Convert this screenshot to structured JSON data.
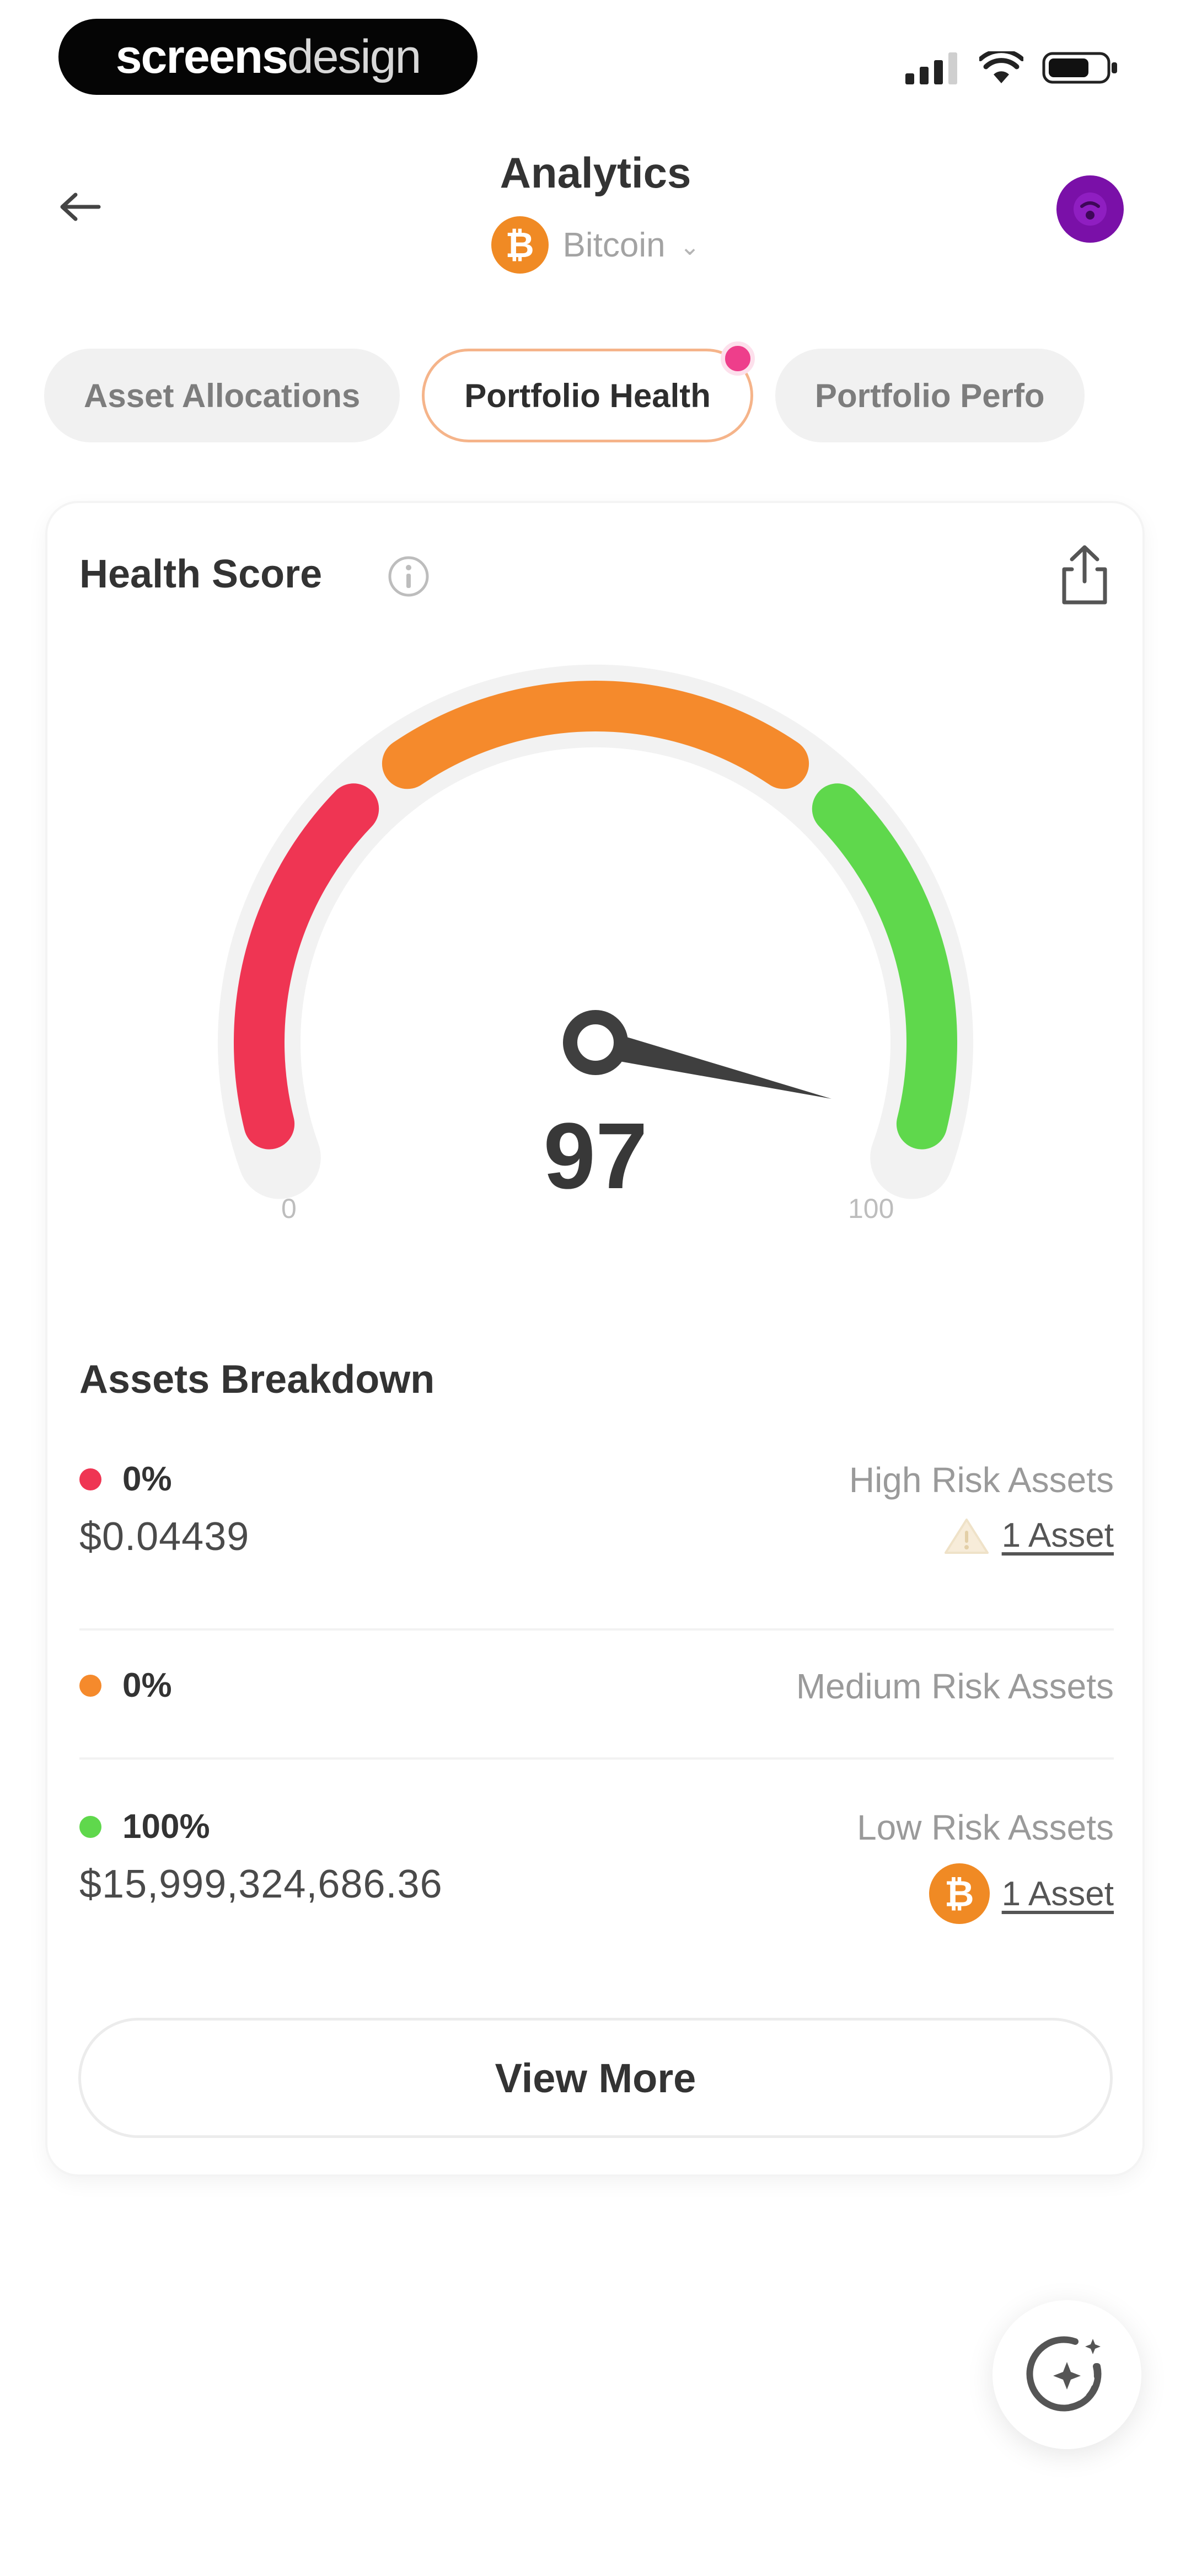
{
  "status_bar": {
    "brand_part1": "screens",
    "brand_part2": "design",
    "icons": [
      "signal-icon",
      "wifi-icon",
      "battery-icon"
    ]
  },
  "header": {
    "title": "Analytics",
    "asset": {
      "symbol": "₿",
      "name": "Bitcoin"
    },
    "back_icon": "arrow-left-icon",
    "avatar_color": "#7a10a8"
  },
  "tabs": [
    {
      "label": "Asset Allocations",
      "active": false
    },
    {
      "label": "Portfolio Health",
      "active": true
    },
    {
      "label": "Portfolio Perfo",
      "active": false
    }
  ],
  "health": {
    "title": "Health Score",
    "score": "97",
    "score_value": 97,
    "min": "0",
    "max": "100",
    "gauge_colors": {
      "low": "#ef3553",
      "mid": "#f58a2c",
      "high": "#5fd84c"
    }
  },
  "breakdown": {
    "title": "Assets Breakdown",
    "rows": [
      {
        "percent": "0%",
        "amount": "$0.04439",
        "risk": "High Risk Assets",
        "asset_count": "1 Asset",
        "color": "#ef3553",
        "asset_icon": "warning-icon"
      },
      {
        "percent": "0%",
        "risk": "Medium Risk Assets",
        "color": "#f58a2c"
      },
      {
        "percent": "100%",
        "amount": "$15,999,324,686.36",
        "risk": "Low Risk Assets",
        "asset_count": "1 Asset",
        "color": "#5fd84c",
        "asset_icon": "bitcoin-icon",
        "asset_symbol": "₿"
      }
    ]
  },
  "actions": {
    "view_more": "View More"
  },
  "fab_icon": "ai-sparkle-icon"
}
